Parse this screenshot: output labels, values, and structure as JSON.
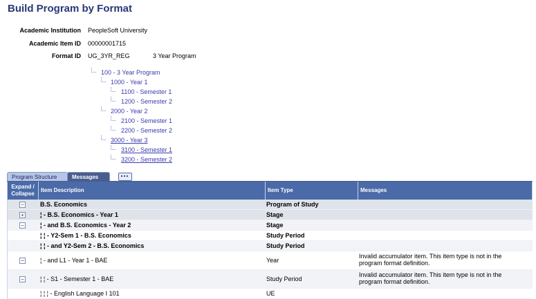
{
  "page": {
    "title": "Build Program by Format"
  },
  "fields": {
    "institution_label": "Academic Institution",
    "institution_value": "PeopleSoft University",
    "item_id_label": "Academic Item ID",
    "item_id_value": "00000001715",
    "format_label": "Format ID",
    "format_value": "UG_3YR_REG",
    "format_desc": "3 Year Program"
  },
  "tree": {
    "root": "100 - 3 Year Program",
    "year1": "1000 - Year 1",
    "y1s1": "1100 - Semester 1",
    "y1s2": "1200 - Semester 2",
    "year2": "2000 - Year 2",
    "y2s1": "2100 - Semester 1",
    "y2s2": "2200 - Semester 2",
    "year3": "3000 - Year 3",
    "y3s1": "3100 - Semester 1",
    "y3s2": "3200 - Semester 2"
  },
  "tabs": {
    "structure": "Program Structure",
    "messages": "Messages",
    "view_all_icon": "grid-view-icon"
  },
  "grid": {
    "headers": {
      "expand_line1": "Expand /",
      "expand_line2": "Collapse",
      "description": "Item Description",
      "type": "Item Type",
      "messages": "Messages"
    },
    "rows": [
      {
        "exp": "−",
        "desc": "B.S. Economics",
        "type": "Program of Study",
        "msg": ""
      },
      {
        "exp": "+",
        "desc": "¦ -  B.S. Economics - Year 1",
        "type": "Stage",
        "msg": ""
      },
      {
        "exp": "−",
        "desc": "¦ -  and B.S. Economics - Year 2",
        "type": "Stage",
        "msg": ""
      },
      {
        "exp": "",
        "desc": "¦    ¦ -  Y2-Sem 1 - B.S. Economics",
        "type": "Study Period",
        "msg": ""
      },
      {
        "exp": "",
        "desc": "¦    ¦ -  and Y2-Sem 2 - B.S. Economics",
        "type": "Study Period",
        "msg": ""
      },
      {
        "exp": "−",
        "desc": "¦ -  and L1 - Year 1 - BAE",
        "type": "Year",
        "msg": "Invalid accumulator item.  This item type is not in the program format definition."
      },
      {
        "exp": "−",
        "desc": "¦    ¦ -  S1 - Semester 1 - BAE",
        "type": "Study Period",
        "msg": "Invalid accumulator item.  This item type is not in the program format definition."
      },
      {
        "exp": "",
        "desc": "¦    ¦    ¦ -  English Language I 101",
        "type": "UE",
        "msg": ""
      }
    ]
  }
}
